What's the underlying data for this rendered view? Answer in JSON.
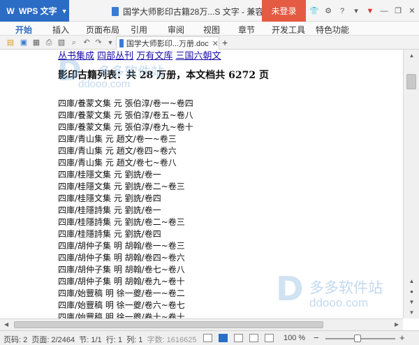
{
  "titlebar": {
    "app_name": "WPS 文字",
    "doc_title": "国学大师影印古籍28万...S 文字 - 兼容模式",
    "login_label": "未登录",
    "help_label": "?"
  },
  "menu": {
    "items": [
      "开始",
      "插入",
      "页面布局",
      "引用",
      "审阅",
      "视图",
      "章节",
      "开发工具",
      "特色功能"
    ]
  },
  "tab": {
    "label": "国学大师影印...万册.doc"
  },
  "document": {
    "links": [
      "丛书集成",
      "四部丛刊",
      "万有文库",
      "三国六朝文"
    ],
    "heading": "影印古籍列表：共 28 万册，本文档共 6272 页",
    "entries": [
      "四庫/養蒙文集 元 張伯淳/卷一~卷四",
      "四庫/養蒙文集 元 張伯淳/卷五~卷八",
      "四庫/養蒙文集 元 張伯淳/卷九~卷十",
      "四庫/青山集 元 趙文/卷一~卷三",
      "四庫/青山集 元 趙文/卷四~卷六",
      "四庫/青山集 元 趙文/卷七~卷八",
      "四庫/桂隱文集 元 劉詵/卷一",
      "四庫/桂隱文集 元 劉詵/卷二~卷三",
      "四庫/桂隱文集 元 劉詵/卷四",
      "四庫/桂隱詩集 元 劉詵/卷一",
      "四庫/桂隱詩集 元 劉詵/卷二~卷三",
      "四庫/桂隱詩集 元 劉詵/卷四",
      "四庫/胡仲子集 明 胡翰/卷一~卷三",
      "四庫/胡仲子集 明 胡翰/卷四~卷六",
      "四庫/胡仲子集 明 胡翰/卷七~卷八",
      "四庫/胡仲子集 明 胡翰/卷九~卷十",
      "四庫/始豐稿 明 徐一夔/卷一~卷二",
      "四庫/始豐稿 明 徐一夔/卷六~卷七",
      "四庫/始豐稿 明 徐一夔/卷十~卷十"
    ],
    "watermark_cn": "多多软件站",
    "watermark_domain": "ddooo.com"
  },
  "status": {
    "page": "页码: 2",
    "pages": "页面: 2/2464",
    "section": "节: 1/1",
    "row": "行: 1",
    "col": "列: 1",
    "words": "字数: 1616625",
    "zoom": "100 %"
  },
  "colors": {
    "app_accent": "#2b6cc4",
    "login_bg": "#e55a43",
    "link": "#1a0dab"
  }
}
